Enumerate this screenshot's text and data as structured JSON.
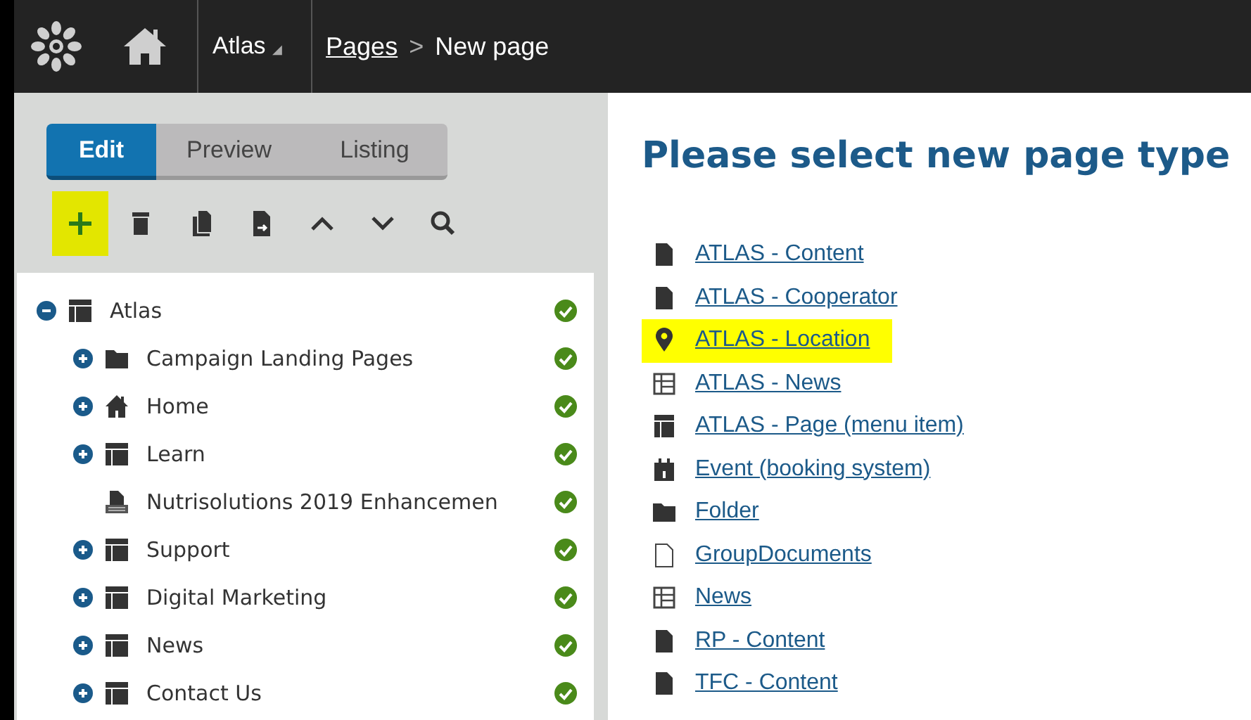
{
  "header": {
    "site": "Atlas",
    "site_caret": "◢",
    "breadcrumb": [
      {
        "label": "Pages",
        "link": true
      },
      {
        "label": "New page",
        "link": false
      }
    ],
    "separator": ">"
  },
  "tabs": [
    {
      "label": "Edit",
      "selected": true
    },
    {
      "label": "Preview",
      "selected": false
    },
    {
      "label": "Listing",
      "selected": false
    }
  ],
  "toolbar": [
    {
      "kind": "add",
      "highlighted": true
    },
    {
      "kind": "delete",
      "highlighted": false
    },
    {
      "kind": "copy",
      "highlighted": false
    },
    {
      "kind": "move",
      "highlighted": false
    },
    {
      "kind": "up",
      "highlighted": false
    },
    {
      "kind": "down",
      "highlighted": false
    },
    {
      "kind": "search",
      "highlighted": false
    }
  ],
  "tree": [
    {
      "label": "Atlas",
      "kind": "layout",
      "expanded": true,
      "published": true,
      "children": [
        {
          "label": "Campaign Landing Pages",
          "kind": "folder",
          "expanded": false,
          "published": true
        },
        {
          "label": "Home",
          "kind": "home",
          "expanded": false,
          "published": true
        },
        {
          "label": "Learn",
          "kind": "layout",
          "expanded": false,
          "published": true
        },
        {
          "label": "Nutrisolutions 2019 Enhancemen",
          "kind": "pdf",
          "published": true
        },
        {
          "label": "Support",
          "kind": "layout",
          "expanded": false,
          "published": true
        },
        {
          "label": "Digital Marketing",
          "kind": "layout",
          "expanded": false,
          "published": true
        },
        {
          "label": "News",
          "kind": "layout",
          "expanded": false,
          "published": true
        },
        {
          "label": "Contact Us",
          "kind": "layout",
          "expanded": false,
          "published": true
        }
      ]
    }
  ],
  "title": "Please select new page type",
  "page_types": [
    {
      "label": "ATLAS - Content",
      "kind": "page",
      "highlighted": false
    },
    {
      "label": "ATLAS - Cooperator",
      "kind": "page",
      "highlighted": false
    },
    {
      "label": "ATLAS - Location",
      "kind": "pin",
      "highlighted": true
    },
    {
      "label": "ATLAS - News",
      "kind": "news",
      "highlighted": false
    },
    {
      "label": "ATLAS - Page (menu item)",
      "kind": "layout",
      "highlighted": false
    },
    {
      "label": "Event (booking system)",
      "kind": "event",
      "highlighted": false
    },
    {
      "label": "Folder",
      "kind": "folder",
      "highlighted": false
    },
    {
      "label": "GroupDocuments",
      "kind": "blank",
      "highlighted": false
    },
    {
      "label": "News",
      "kind": "news",
      "highlighted": false
    },
    {
      "label": "RP - Content",
      "kind": "page",
      "highlighted": false
    },
    {
      "label": "TFC - Content",
      "kind": "page",
      "highlighted": false
    }
  ]
}
